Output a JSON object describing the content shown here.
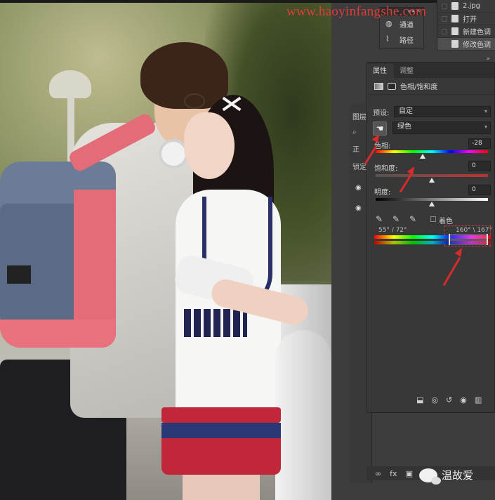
{
  "watermark": "www.haoyinfangshe.com",
  "channels_panel": {
    "items": [
      {
        "label": "通道",
        "icon": "channels-icon"
      },
      {
        "label": "路径",
        "icon": "paths-icon"
      }
    ]
  },
  "history_panel": {
    "items": [
      {
        "label": "2.jpg",
        "icon": "image-icon"
      },
      {
        "label": "打开",
        "icon": "document-icon"
      },
      {
        "label": "新建色调",
        "icon": "document-icon"
      },
      {
        "label": "修改色调",
        "icon": "document-icon",
        "selected": true
      }
    ]
  },
  "layers_panel": {
    "tab_label": "图层",
    "blend_mode": "正",
    "lock_label": "锁定"
  },
  "properties_panel": {
    "tabs": [
      {
        "label": "属性",
        "active": true
      },
      {
        "label": "调整",
        "active": false
      }
    ],
    "title": "色相/饱和度",
    "preset_label": "预设:",
    "preset_value": "自定",
    "channel_value": "绿色",
    "hue": {
      "label": "色相:",
      "value": "-28",
      "thumb_fraction": 0.42
    },
    "saturation": {
      "label": "饱和度:",
      "value": "0",
      "thumb_fraction": 0.5
    },
    "lightness": {
      "label": "明度:",
      "value": "0",
      "thumb_fraction": 0.5
    },
    "colorize_label": "着色",
    "range_left": "55° / 72°",
    "range_right": "160° \\ 167°"
  },
  "footer_icons": [
    "clip-to-layer-icon",
    "visibility-toggle-icon",
    "reset-icon",
    "eye-icon",
    "trash-icon"
  ],
  "bottom_icons": [
    "link-icon",
    "fx-icon",
    "mask-icon"
  ],
  "wechat": {
    "name": "温故爱"
  },
  "colors": {
    "panel_bg": "#383838",
    "annotation_red": "#d62b2b",
    "watermark_red": "#e03b3b"
  }
}
